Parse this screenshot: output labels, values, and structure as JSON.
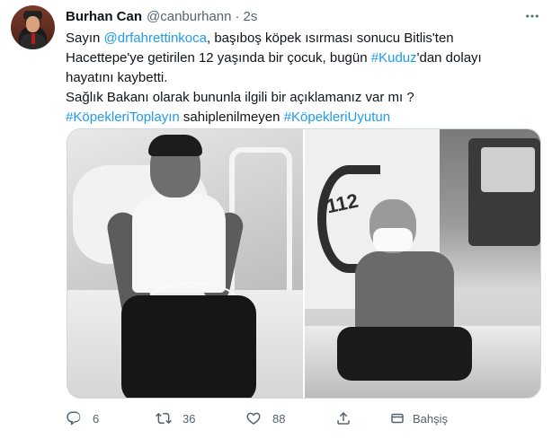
{
  "tweet": {
    "author": {
      "display_name": "Burhan Can",
      "handle": "@canburhann",
      "avatar_icon": "avatar-icon"
    },
    "separator": "·",
    "time": "2s",
    "body": {
      "line1": {
        "prefix": "Sayın ",
        "mention": "@drfahrettinkoca",
        "suffix": ", başıboş köpek ısırması sonucu Bitlis'ten"
      },
      "line2": {
        "prefix": "Hacettepe'ye getirilen 12 yaşında bir çocuk, bugün ",
        "hashtag": "#Kuduz",
        "suffix": "'dan dolayı"
      },
      "line3": "hayatını kaybetti.",
      "line4": "Sağlık Bakanı olarak bununla ilgili bir açıklamanız var mı ?",
      "line5": {
        "hashtag1": "#KöpekleriToplayın",
        "middle": " sahiplenilmeyen ",
        "hashtag2": "#KöpekleriUyutun"
      }
    },
    "media": {
      "photo_right_text": "112"
    },
    "actions": {
      "reply": {
        "icon": "reply-icon",
        "count": "6"
      },
      "retweet": {
        "icon": "retweet-icon",
        "count": "36"
      },
      "like": {
        "icon": "heart-icon",
        "count": "88"
      },
      "analytics": {
        "icon": "analytics-icon"
      },
      "tip": {
        "icon": "tip-icon",
        "label": "Bahşiş"
      }
    },
    "more_icon": "more-icon"
  },
  "colors": {
    "link": "#1d9bf0",
    "text": "#0f1419",
    "secondary": "#536471",
    "border": "#cfd9de"
  }
}
